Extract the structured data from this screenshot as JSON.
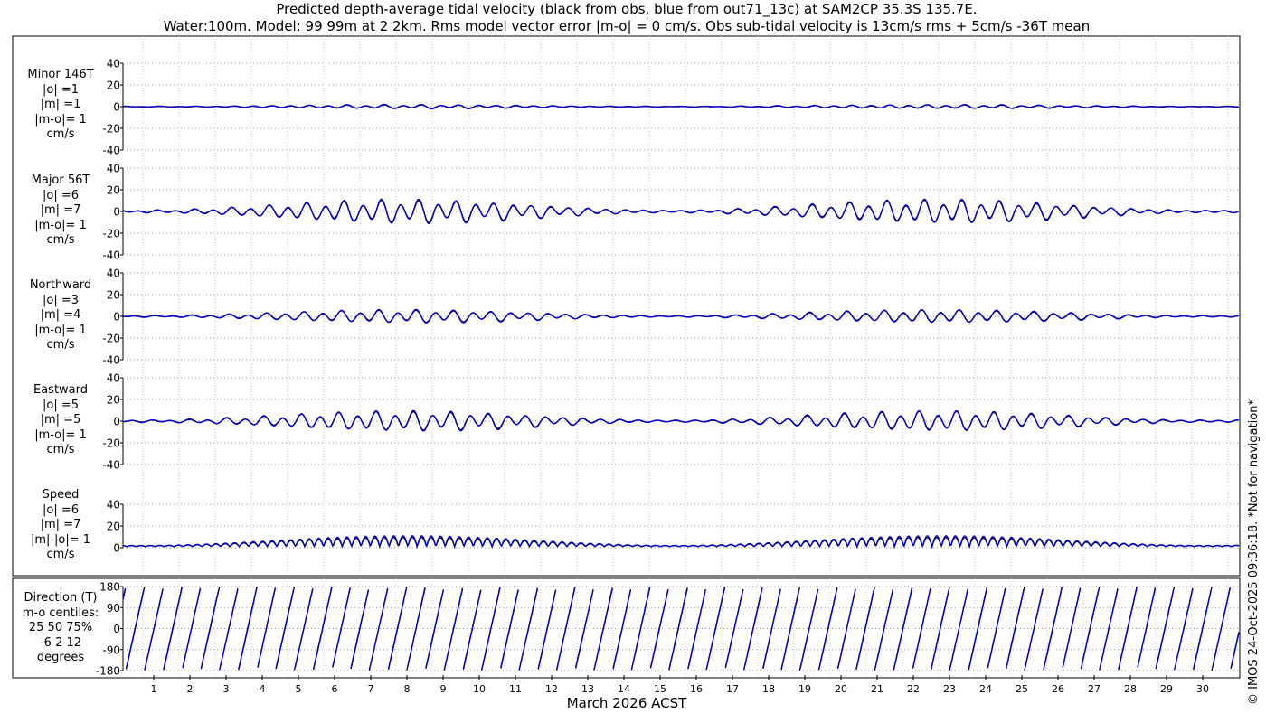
{
  "title": {
    "line1": "Predicted depth-average tidal velocity (black from obs, blue from out71_13c) at SAM2CP 35.3S 135.7E.",
    "line2": "Water:100m. Model: 99 99m at 2 2km. Rms model vector error |m-o| = 0 cm/s. Obs sub-tidal velocity is 13cm/s rms + 5cm/s -36T mean"
  },
  "xlabel": "March 2026 ACST",
  "copyright": "© IMOS 24-Oct-2025 09:36:18. *Not for navigation*",
  "colors": {
    "obs": "#000000",
    "model": "#0000cc",
    "grid": "#999999"
  },
  "chart_data": [
    {
      "type": "line",
      "panel": "minor",
      "label_lines": [
        "Minor 146T",
        "|o| =1",
        "|m| =1",
        "|m-o|= 1",
        "cm/s"
      ],
      "ylim": [
        -40,
        40
      ],
      "yticks": [
        -40,
        -20,
        0,
        20,
        40
      ],
      "amplitude": 1.6,
      "series": [
        {
          "name": "obs"
        },
        {
          "name": "model"
        }
      ]
    },
    {
      "type": "line",
      "panel": "major",
      "label_lines": [
        "Major 56T",
        "|o| =6",
        "|m| =7",
        "|m-o|= 1",
        "cm/s"
      ],
      "ylim": [
        -40,
        40
      ],
      "yticks": [
        -40,
        -20,
        0,
        20,
        40
      ],
      "amplitude": 10,
      "series": [
        {
          "name": "obs"
        },
        {
          "name": "model"
        }
      ]
    },
    {
      "type": "line",
      "panel": "northward",
      "label_lines": [
        "Northward",
        "|o| =3",
        "|m| =4",
        "|m-o|= 1",
        "cm/s"
      ],
      "ylim": [
        -40,
        40
      ],
      "yticks": [
        -40,
        -20,
        0,
        20,
        40
      ],
      "amplitude": 5.5,
      "series": [
        {
          "name": "obs"
        },
        {
          "name": "model"
        }
      ]
    },
    {
      "type": "line",
      "panel": "eastward",
      "label_lines": [
        "Eastward",
        "|o| =5",
        "|m| =5",
        "|m-o|= 1",
        "cm/s"
      ],
      "ylim": [
        -40,
        40
      ],
      "yticks": [
        -40,
        -20,
        0,
        20,
        40
      ],
      "amplitude": 8.5,
      "series": [
        {
          "name": "obs"
        },
        {
          "name": "model"
        }
      ]
    },
    {
      "type": "line",
      "panel": "speed",
      "label_lines": [
        "Speed",
        "|o| =6",
        "|m| =7",
        "|m|-|o|= 1",
        "cm/s"
      ],
      "ylim": [
        0,
        40
      ],
      "yticks": [
        0,
        20,
        40
      ],
      "amplitude": 10,
      "series": [
        {
          "name": "obs"
        },
        {
          "name": "model"
        }
      ]
    },
    {
      "type": "line",
      "panel": "direction",
      "label_lines": [
        "Direction (T)",
        "m-o centiles:",
        "25  50  75%",
        "-6   2  12",
        "degrees"
      ],
      "ylim": [
        -180,
        180
      ],
      "yticks": [
        -180,
        -90,
        0,
        90,
        180
      ],
      "series": [
        {
          "name": "obs"
        },
        {
          "name": "model"
        }
      ]
    }
  ],
  "x_axis": {
    "unit": "day of March 2026",
    "xlim": [
      0.15,
      31.0
    ],
    "tick_labels": [
      "1",
      "2",
      "3",
      "4",
      "5",
      "6",
      "7",
      "8",
      "9",
      "10",
      "11",
      "12",
      "13",
      "14",
      "15",
      "16",
      "17",
      "18",
      "19",
      "20",
      "21",
      "22",
      "23",
      "24",
      "25",
      "26",
      "27",
      "28",
      "29",
      "30"
    ]
  }
}
